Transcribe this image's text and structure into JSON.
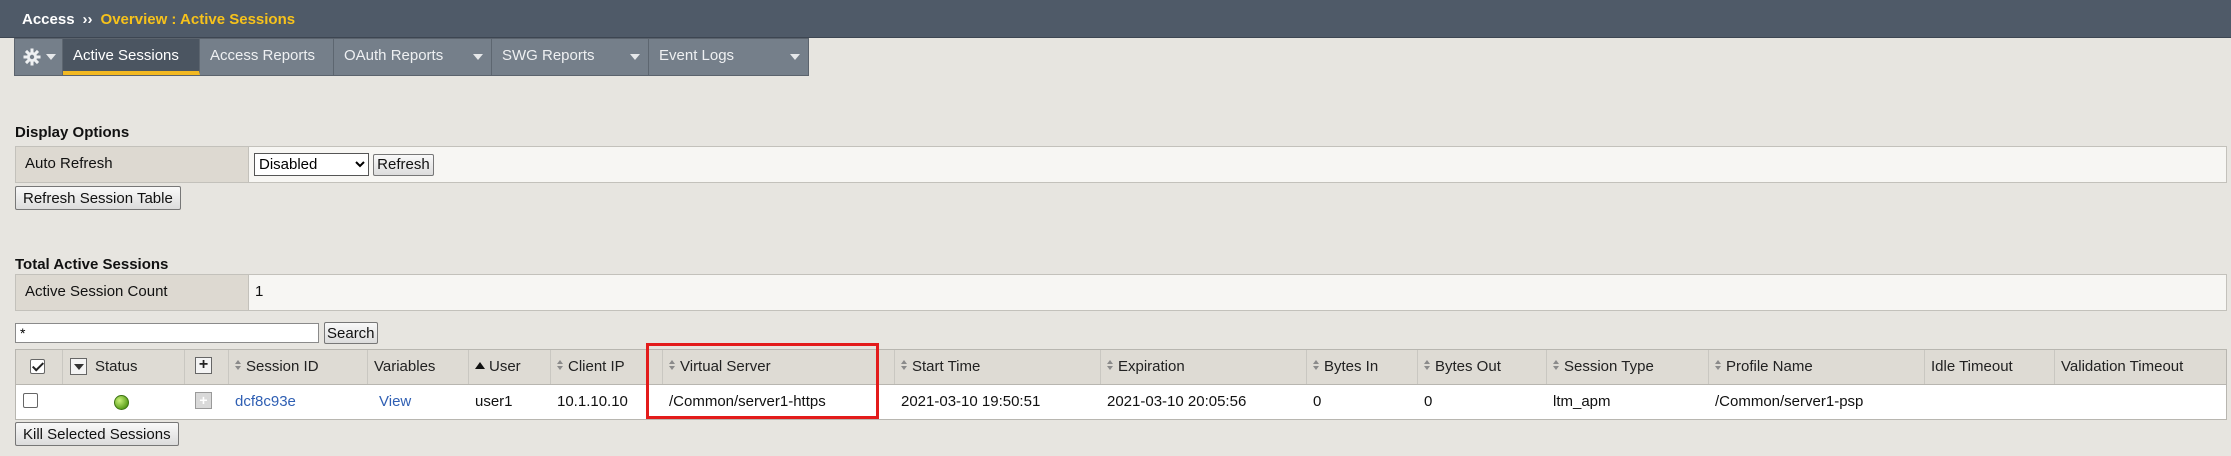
{
  "breadcrumb": {
    "root": "Access",
    "separator": "››",
    "current": "Overview : Active Sessions"
  },
  "tabs": {
    "gear_icon": "gear-icon",
    "items": [
      {
        "label": "Active Sessions",
        "active": true,
        "has_menu": false
      },
      {
        "label": "Access Reports",
        "active": false,
        "has_menu": false
      },
      {
        "label": "OAuth Reports",
        "active": false,
        "has_menu": true
      },
      {
        "label": "SWG Reports",
        "active": false,
        "has_menu": true
      },
      {
        "label": "Event Logs",
        "active": false,
        "has_menu": true
      }
    ]
  },
  "display_options": {
    "title": "Display Options",
    "auto_refresh_label": "Auto Refresh",
    "auto_refresh_value": "Disabled",
    "refresh_button": "Refresh",
    "refresh_table_button": "Refresh Session Table"
  },
  "total_sessions": {
    "title": "Total Active Sessions",
    "count_label": "Active Session Count",
    "count_value": "1"
  },
  "search": {
    "value": "*",
    "button": "Search"
  },
  "table": {
    "headers": {
      "status": "Status",
      "session_id": "Session ID",
      "variables": "Variables",
      "user": "User",
      "client_ip": "Client IP",
      "virtual_server": "Virtual Server",
      "start_time": "Start Time",
      "expiration": "Expiration",
      "bytes_in": "Bytes In",
      "bytes_out": "Bytes Out",
      "session_type": "Session Type",
      "profile_name": "Profile Name",
      "idle_timeout": "Idle Timeout",
      "validation_timeout": "Validation Timeout"
    },
    "rows": [
      {
        "status": "green",
        "session_id": "dcf8c93e",
        "variables": "View",
        "user": "user1",
        "client_ip": "10.1.10.10",
        "virtual_server": "/Common/server1-https",
        "start_time": "2021-03-10 19:50:51",
        "expiration": "2021-03-10 20:05:56",
        "bytes_in": "0",
        "bytes_out": "0",
        "session_type": "ltm_apm",
        "profile_name": "/Common/server1-psp",
        "idle_timeout": "",
        "validation_timeout": ""
      }
    ]
  },
  "kill_button": "Kill Selected Sessions",
  "colors": {
    "highlight": "#e31b1b",
    "breadcrumb_current": "#f7c21b",
    "active_tab_underline": "#f2b822",
    "link": "#2f5fb3"
  }
}
